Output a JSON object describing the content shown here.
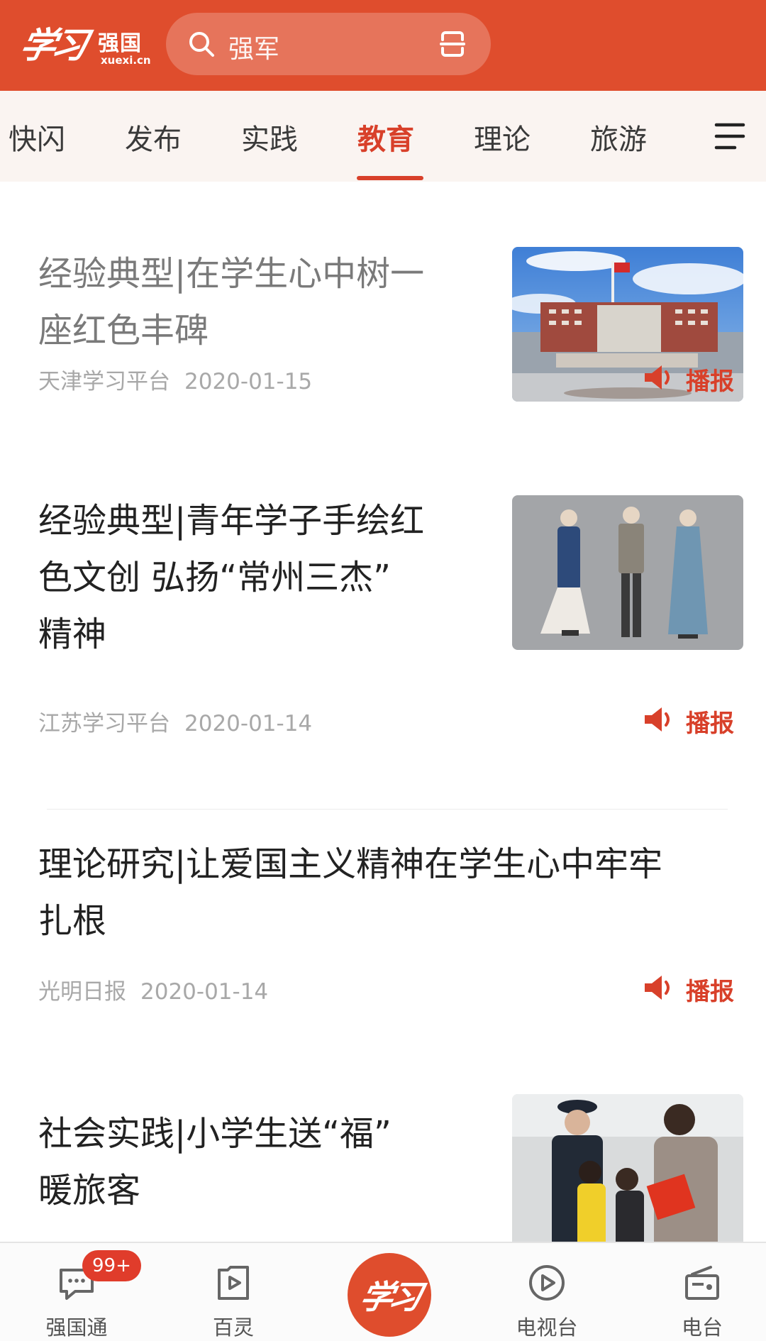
{
  "header": {
    "logo_script": "学习",
    "logo_name": "强国",
    "logo_domain": "xuexi.cn",
    "search_text": "强军"
  },
  "tabs": [
    {
      "label": "快闪",
      "active": false
    },
    {
      "label": "发布",
      "active": false
    },
    {
      "label": "实践",
      "active": false
    },
    {
      "label": "教育",
      "active": true
    },
    {
      "label": "理论",
      "active": false
    },
    {
      "label": "旅游",
      "active": false
    }
  ],
  "articles": [
    {
      "title_line1": "经验典型|在学生心中树一",
      "title_line2": "座红色丰碑",
      "source": "天津学习平台",
      "date": "2020-01-15",
      "play_label": "播报"
    },
    {
      "title_line1": "经验典型|青年学子手绘红",
      "title_line2": "色文创 弘扬“常州三杰”",
      "title_line3": "精神",
      "source": "江苏学习平台",
      "date": "2020-01-14",
      "play_label": "播报"
    },
    {
      "title_line1": "理论研究|让爱国主义精神在学生心中牢牢",
      "title_line2": "扎根",
      "source": "光明日报",
      "date": "2020-01-14",
      "play_label": "播报"
    },
    {
      "title_line1": "社会实践|小学生送“福”",
      "title_line2": "暖旅客"
    }
  ],
  "bottom_nav": {
    "items": [
      {
        "label": "强国通"
      },
      {
        "label": "百灵"
      },
      {
        "label": "学习"
      },
      {
        "label": "电视台"
      },
      {
        "label": "电台"
      }
    ],
    "badge": "99+"
  },
  "colors": {
    "brand": "#df4d2d",
    "accent_text": "#d8402a",
    "tab_bar_bg": "#faf4f1"
  }
}
